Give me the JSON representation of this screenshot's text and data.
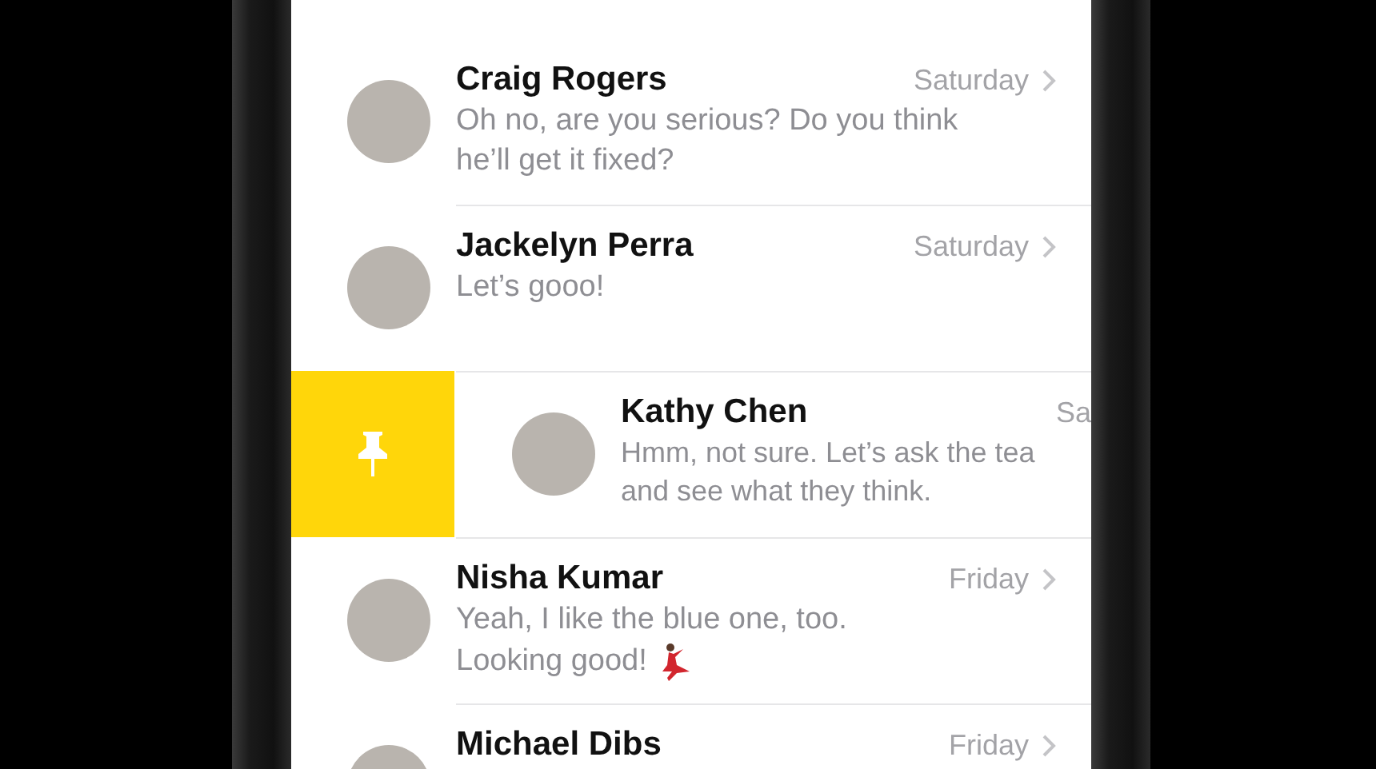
{
  "conversations": [
    {
      "kind": "normal",
      "name": "Craig Rogers",
      "time": "Saturday",
      "preview": [
        "Oh no, are you serious? Do you think",
        "he’ll get it fixed?"
      ]
    },
    {
      "kind": "normal",
      "name": "Jackelyn Perra",
      "time": "Saturday",
      "preview": [
        "Let’s gooo!"
      ]
    },
    {
      "kind": "swiped",
      "name": "Kathy Chen",
      "time": "Sa",
      "preview": [
        "Hmm, not sure. Let’s ask the tea",
        "and see what they think."
      ]
    },
    {
      "kind": "emoji",
      "name": "Nisha Kumar",
      "time": "Friday",
      "preview": [
        "Yeah, I like the blue one, too.",
        "Looking good!"
      ]
    },
    {
      "kind": "normal",
      "name": "Michael Dibs",
      "time": "Friday"
    }
  ]
}
